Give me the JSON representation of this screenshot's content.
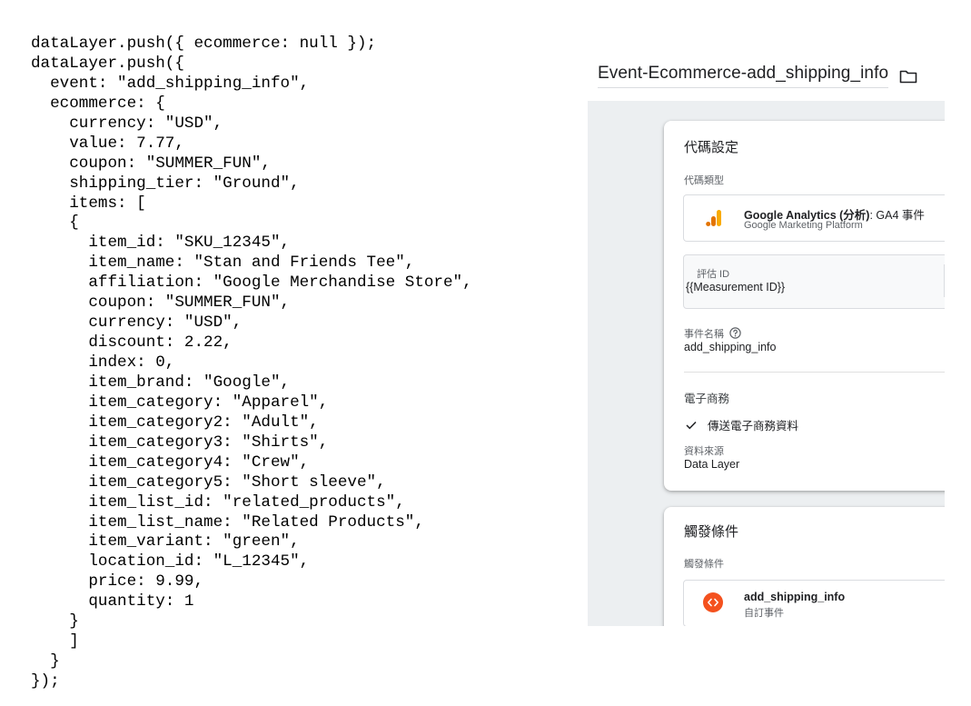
{
  "code": {
    "lines": [
      "dataLayer.push({ ecommerce: null });",
      "dataLayer.push({",
      "  event: \"add_shipping_info\",",
      "  ecommerce: {",
      "    currency: \"USD\",",
      "    value: 7.77,",
      "    coupon: \"SUMMER_FUN\",",
      "    shipping_tier: \"Ground\",",
      "    items: [",
      "    {",
      "      item_id: \"SKU_12345\",",
      "      item_name: \"Stan and Friends Tee\",",
      "      affiliation: \"Google Merchandise Store\",",
      "      coupon: \"SUMMER_FUN\",",
      "      currency: \"USD\",",
      "      discount: 2.22,",
      "      index: 0,",
      "      item_brand: \"Google\",",
      "      item_category: \"Apparel\",",
      "      item_category2: \"Adult\",",
      "      item_category3: \"Shirts\",",
      "      item_category4: \"Crew\",",
      "      item_category5: \"Short sleeve\",",
      "      item_list_id: \"related_products\",",
      "      item_list_name: \"Related Products\",",
      "      item_variant: \"green\",",
      "      location_id: \"L_12345\",",
      "      price: 9.99,",
      "      quantity: 1",
      "    }",
      "    ]",
      "  }",
      "});"
    ]
  },
  "tag": {
    "name": "Event-Ecommerce-add_shipping_info",
    "folder_icon": "folder-icon"
  },
  "tag_config": {
    "title": "代碼設定",
    "type_label": "代碼類型",
    "type_name_bold": "Google Analytics (分析)",
    "type_name_rest": ": GA4 事件",
    "type_platform": "Google Marketing Platform",
    "measurement_label": "評估 ID",
    "measurement_value": "{{Measurement ID}}",
    "event_name_label": "事件名稱",
    "event_name_value": "add_shipping_info",
    "ecommerce_label": "電子商務",
    "send_ecommerce": "傳送電子商務資料",
    "data_source_label": "資料來源",
    "data_source_value": "Data Layer"
  },
  "triggering": {
    "title": "觸發條件",
    "label": "觸發條件",
    "trigger_name": "add_shipping_info",
    "trigger_type": "自訂事件"
  },
  "colors": {
    "analytics_orange": "#f9ab00",
    "analytics_dark": "#e37400",
    "trigger_orange": "#f4511e"
  }
}
